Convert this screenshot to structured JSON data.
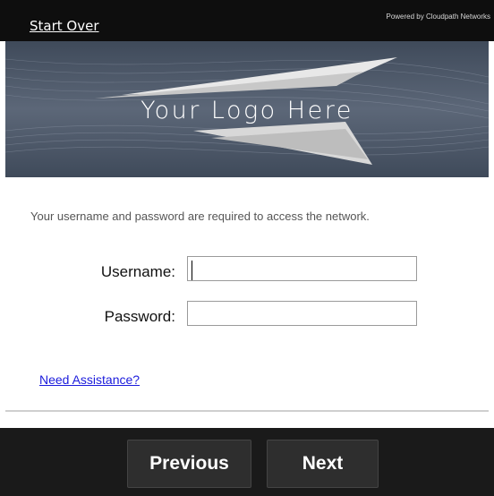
{
  "header": {
    "start_over": "Start Over",
    "powered_by": "Powered by Cloudpath Networks"
  },
  "banner": {
    "logo_text": "Your Logo Here"
  },
  "form": {
    "prompt": "Your username and password are required to access the network.",
    "username_label": "Username:",
    "username_value": "",
    "password_label": "Password:",
    "password_value": "",
    "assistance_link": "Need Assistance?"
  },
  "footer": {
    "previous_label": "Previous",
    "next_label": "Next"
  },
  "colors": {
    "topbar_bg": "#0e0e0e",
    "banner_bg": "#4f5a6a",
    "link": "#1b1bdc",
    "footer_bg": "#1a1a1a",
    "button_bg": "#2e2e2e"
  }
}
